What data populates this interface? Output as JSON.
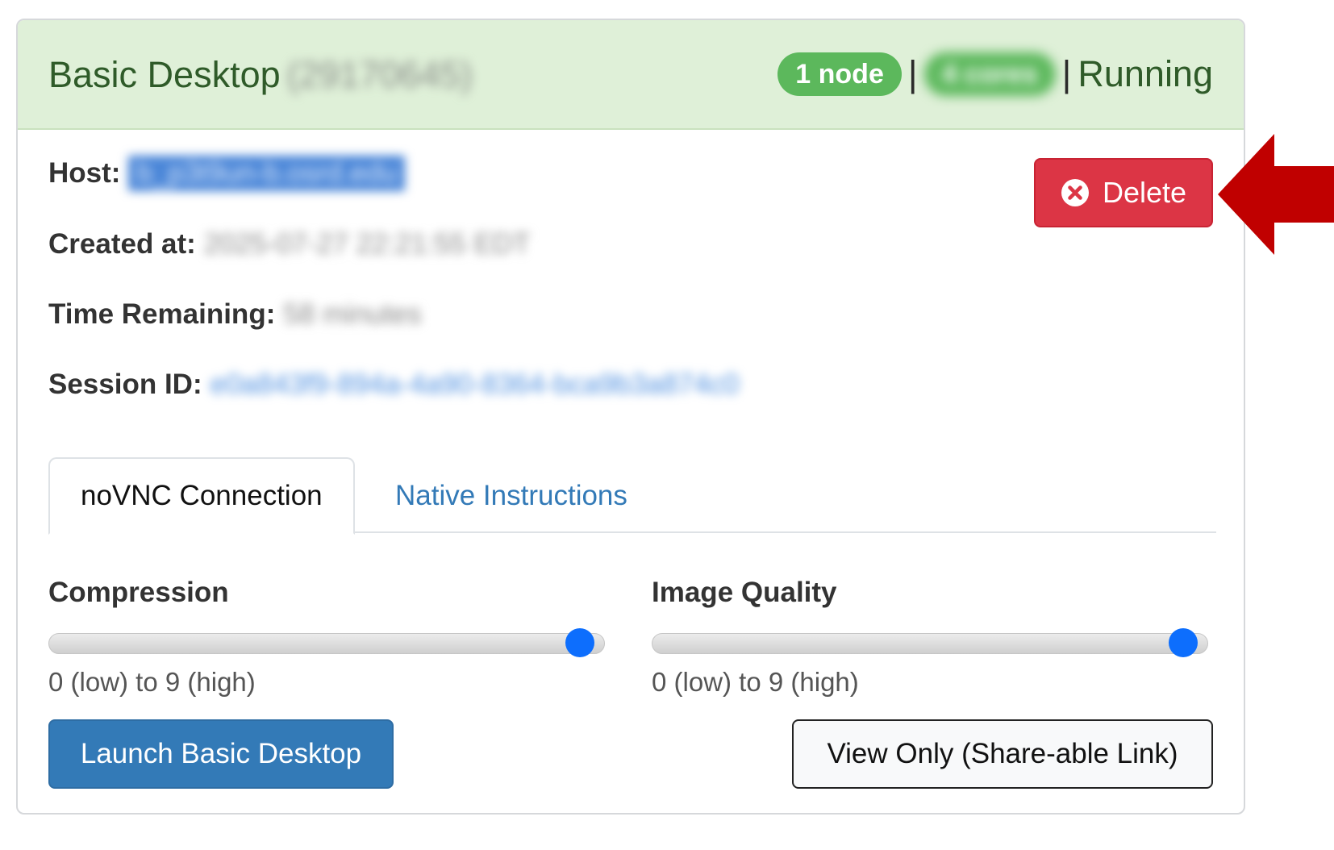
{
  "header": {
    "title": "Basic Desktop",
    "job_id": "(29170645)",
    "nodes_badge": "1 node",
    "separator": "|",
    "cores_badge": "4 cores",
    "status": "Running"
  },
  "info": {
    "host_label": "Host:",
    "host_value": "b_p3t9un-b.osrd.edu",
    "created_label": "Created at:",
    "created_value": "2025-07-27 22:21:55 EDT",
    "remaining_label": "Time Remaining:",
    "remaining_value": "58 minutes",
    "session_label": "Session ID:",
    "session_value": "e0a843f9-894a-4a90-8364-bca9b3a874c0"
  },
  "delete_button": {
    "label": "Delete"
  },
  "tabs": [
    {
      "label": "noVNC Connection",
      "active": true
    },
    {
      "label": "Native Instructions",
      "active": false
    }
  ],
  "sliders": {
    "compression": {
      "label": "Compression",
      "hint": "0 (low) to 9 (high)",
      "value": 9,
      "min": 0,
      "max": 9
    },
    "image_quality": {
      "label": "Image Quality",
      "hint": "0 (low) to 9 (high)",
      "value": 9,
      "min": 0,
      "max": 9
    }
  },
  "buttons": {
    "launch": "Launch Basic Desktop",
    "view_only": "View Only (Share-able Link)"
  },
  "colors": {
    "header_bg": "#dff0d8",
    "badge": "#5cb85c",
    "delete": "#dc3545",
    "primary": "#337ab7",
    "slider_thumb": "#0d6efd",
    "annotation_arrow": "#c00000"
  }
}
